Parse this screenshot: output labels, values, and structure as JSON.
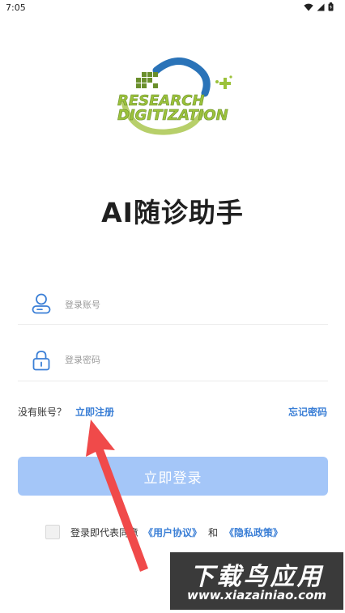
{
  "status_bar": {
    "time": "7:05"
  },
  "logo": {
    "line1": "RESEARCH",
    "line2": "DIGITIZATION"
  },
  "app": {
    "title": "AI随诊助手"
  },
  "form": {
    "account_placeholder": "登录账号",
    "password_placeholder": "登录密码",
    "no_account_text": "没有账号？",
    "register_label": "立即注册",
    "forgot_label": "忘记密码",
    "login_label": "立即登录"
  },
  "agreement": {
    "prefix": "登录即代表同意",
    "user_agreement": "《用户协议》",
    "and": "和",
    "privacy_policy": "《隐私政策》"
  },
  "watermark": {
    "title": "下载鸟应用",
    "url": "www.xiazainiao.com"
  },
  "colors": {
    "accent": "#3b7fd6",
    "button": "#a4c6f8",
    "logo_green": "#9cc23b",
    "logo_blue": "#2a73b8"
  }
}
